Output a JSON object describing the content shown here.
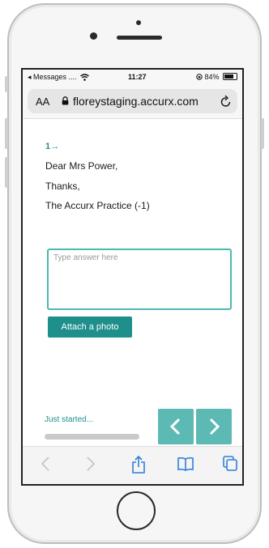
{
  "status_bar": {
    "carrier": "◂ Messages ....",
    "time": "11:27",
    "battery": "84%"
  },
  "browser": {
    "text_size_label": "AA",
    "url": "floreystaging.accurx.com"
  },
  "question": {
    "step_marker": "1→",
    "lines": [
      "Dear Mrs Power,",
      "Thanks,",
      "The Accurx Practice (-1)"
    ]
  },
  "answer": {
    "placeholder": "Type answer here",
    "value": ""
  },
  "attach_label": "Attach a photo",
  "progress": {
    "label": "Just started...",
    "fraction": 0
  },
  "colors": {
    "accent": "#1f8f8c",
    "nav_button": "#5db9b4",
    "input_border": "#4cb8b2"
  },
  "icons": {
    "back": "chevron-left-icon",
    "forward": "chevron-right-icon",
    "toolbar": [
      "browser-back-icon",
      "browser-forward-icon",
      "share-icon",
      "bookmarks-icon",
      "tabs-icon"
    ]
  }
}
